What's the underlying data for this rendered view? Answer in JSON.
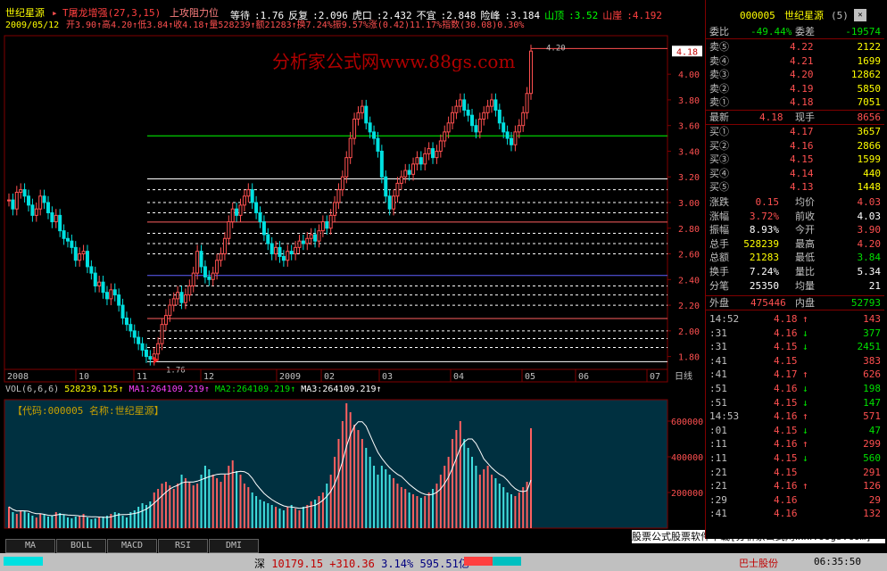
{
  "header": {
    "stock_name": "世纪星源",
    "indicator": "T屠龙增强(27,3,15)",
    "support": "上攻阻力位",
    "fields": [
      {
        "label": "等待",
        "value": "1.76"
      },
      {
        "label": "反复",
        "value": "2.096"
      },
      {
        "label": "虎口",
        "value": "2.432"
      },
      {
        "label": "不宜",
        "value": "2.848"
      },
      {
        "label": "险峰",
        "value": "3.184"
      },
      {
        "label": "山顶",
        "value": "3.52"
      },
      {
        "label": "山崖",
        "value": "4.192"
      }
    ],
    "date": "2009/05/12",
    "day_stats": "开3.90↑高4.20↑低3.84↑收4.18↑量528239↑额21283↑换7.24%振9.57%涨(0.42)11.17%指数(30.08)0.30%"
  },
  "watermark": "分析家公式网www.88gs.com",
  "chart_data": {
    "type": "candlestick",
    "price_axis": {
      "min": 1.7,
      "max": 4.3,
      "ticks": [
        "4.00",
        "3.80",
        "3.60",
        "3.40",
        "3.20",
        "3.00",
        "2.80",
        "2.60",
        "2.40",
        "2.20",
        "2.00",
        "1.80"
      ],
      "current_label": "4.18"
    },
    "time_axis": [
      "2008",
      "10",
      "11",
      "12",
      "2009",
      "02",
      "03",
      "04",
      "05",
      "06",
      "07"
    ],
    "annotations": {
      "high_label": "4.20",
      "low_label": "1.76",
      "period": "日线"
    },
    "levels": [
      3.52,
      3.184,
      3.1,
      3.0,
      2.92,
      2.848,
      2.76,
      2.68,
      2.6,
      2.432,
      2.35,
      2.28,
      2.2,
      2.096,
      2.0,
      1.94,
      1.87,
      1.76
    ],
    "closes": [
      3.02,
      2.95,
      3.08,
      3.1,
      3.05,
      2.98,
      2.9,
      2.95,
      3.05,
      3.0,
      2.92,
      2.85,
      2.9,
      2.78,
      2.72,
      2.7,
      2.65,
      2.55,
      2.6,
      2.62,
      2.5,
      2.45,
      2.35,
      2.38,
      2.3,
      2.25,
      2.32,
      2.28,
      2.2,
      2.1,
      2.05,
      2.0,
      1.95,
      1.9,
      1.85,
      1.8,
      1.78,
      1.82,
      1.9,
      2.05,
      2.12,
      2.2,
      2.25,
      2.3,
      2.22,
      2.28,
      2.35,
      2.45,
      2.62,
      2.5,
      2.42,
      2.4,
      2.45,
      2.55,
      2.6,
      2.72,
      2.85,
      2.95,
      2.9,
      2.98,
      3.05,
      3.1,
      3.0,
      2.92,
      2.85,
      2.75,
      2.68,
      2.6,
      2.65,
      2.58,
      2.55,
      2.62,
      2.6,
      2.65,
      2.7,
      2.68,
      2.72,
      2.75,
      2.7,
      2.78,
      2.85,
      2.8,
      2.9,
      3.0,
      3.1,
      3.2,
      3.35,
      3.5,
      3.65,
      3.7,
      3.75,
      3.62,
      3.55,
      3.5,
      3.4,
      3.2,
      3.05,
      2.95,
      3.05,
      3.15,
      3.2,
      3.25,
      3.22,
      3.3,
      3.35,
      3.3,
      3.38,
      3.42,
      3.35,
      3.4,
      3.48,
      3.55,
      3.62,
      3.7,
      3.75,
      3.8,
      3.72,
      3.68,
      3.6,
      3.55,
      3.65,
      3.7,
      3.75,
      3.8,
      3.72,
      3.62,
      3.55,
      3.5,
      3.45,
      3.55,
      3.6,
      3.7,
      3.85,
      4.18
    ],
    "volume": {
      "label": "VOL(6,6,6)",
      "value": "528239.125",
      "ma1": "MA1:264109.219",
      "ma2": "MA2:264109.219",
      "ma3": "MA3:264109.219",
      "ticks": [
        "600000",
        "400000",
        "200000"
      ],
      "max": 720000
    },
    "volumes": [
      120000,
      90000,
      80000,
      100000,
      95000,
      85000,
      70000,
      60000,
      80000,
      75000,
      65000,
      70000,
      90000,
      85000,
      75000,
      60000,
      55000,
      65000,
      70000,
      80000,
      60000,
      50000,
      55000,
      60000,
      65000,
      70000,
      80000,
      90000,
      85000,
      70000,
      60000,
      90000,
      100000,
      120000,
      140000,
      130000,
      150000,
      200000,
      220000,
      250000,
      260000,
      240000,
      220000,
      250000,
      300000,
      280000,
      260000,
      240000,
      250000,
      300000,
      350000,
      330000,
      300000,
      280000,
      260000,
      300000,
      350000,
      380000,
      320000,
      300000,
      250000,
      230000,
      200000,
      180000,
      160000,
      150000,
      140000,
      130000,
      120000,
      110000,
      100000,
      120000,
      130000,
      110000,
      100000,
      120000,
      130000,
      150000,
      160000,
      180000,
      200000,
      250000,
      300000,
      400000,
      500000,
      600000,
      700000,
      650000,
      580000,
      550000,
      500000,
      450000,
      400000,
      350000,
      300000,
      350000,
      330000,
      300000,
      280000,
      250000,
      230000,
      220000,
      200000,
      190000,
      180000,
      170000,
      180000,
      200000,
      220000,
      250000,
      300000,
      350000,
      400000,
      500000,
      550000,
      600000,
      500000,
      450000,
      400000,
      350000,
      300000,
      330000,
      350000,
      300000,
      280000,
      250000,
      230000,
      200000,
      190000,
      180000,
      200000,
      230000,
      260000,
      560000
    ]
  },
  "sub_window": {
    "title": "【代码:000005 名称:世纪星源】"
  },
  "right": {
    "code": "000005",
    "name": "世纪星源",
    "tag": "(5)",
    "weibi_label": "委比",
    "weibi_value": "-49.44%",
    "weicha_label": "委差",
    "weicha_value": "-19574",
    "sell": [
      {
        "label": "卖⑤",
        "price": "4.22",
        "vol": "2122"
      },
      {
        "label": "卖④",
        "price": "4.21",
        "vol": "1699"
      },
      {
        "label": "卖③",
        "price": "4.20",
        "vol": "12862"
      },
      {
        "label": "卖②",
        "price": "4.19",
        "vol": "5850"
      },
      {
        "label": "卖①",
        "price": "4.18",
        "vol": "7051"
      }
    ],
    "latest": {
      "label": "最新",
      "price": "4.18",
      "label2": "现手",
      "vol": "8656"
    },
    "buy": [
      {
        "label": "买①",
        "price": "4.17",
        "vol": "3657"
      },
      {
        "label": "买②",
        "price": "4.16",
        "vol": "2866"
      },
      {
        "label": "买③",
        "price": "4.15",
        "vol": "1599"
      },
      {
        "label": "买④",
        "price": "4.14",
        "vol": "440"
      },
      {
        "label": "买⑤",
        "price": "4.13",
        "vol": "1448"
      }
    ],
    "stats": [
      {
        "l1": "涨跌",
        "v1": "0.15",
        "l2": "均价",
        "v2": "4.03"
      },
      {
        "l1": "涨幅",
        "v1": "3.72%",
        "l2": "前收",
        "v2": "4.03"
      },
      {
        "l1": "振幅",
        "v1": "8.93%",
        "l2": "今开",
        "v2": "3.90"
      },
      {
        "l1": "总手",
        "v1": "528239",
        "l2": "最高",
        "v2": "4.20"
      },
      {
        "l1": "总额",
        "v1": "21283",
        "l2": "最低",
        "v2": "3.84"
      },
      {
        "l1": "换手",
        "v1": "7.24%",
        "l2": "量比",
        "v2": "5.34"
      },
      {
        "l1": "分笔",
        "v1": "25350",
        "l2": "均量",
        "v2": "21"
      }
    ],
    "outer": {
      "l1": "外盘",
      "v1": "475446",
      "l2": "内盘",
      "v2": "52793"
    },
    "ticks": [
      {
        "t": "14:52",
        "p": "4.18",
        "d": "up",
        "v": "143"
      },
      {
        "t": ":31",
        "p": "4.16",
        "d": "down",
        "v": "377"
      },
      {
        "t": ":31",
        "p": "4.15",
        "d": "down",
        "v": "2451"
      },
      {
        "t": ":41",
        "p": "4.15",
        "d": "",
        "v": "383"
      },
      {
        "t": ":41",
        "p": "4.17",
        "d": "up",
        "v": "626"
      },
      {
        "t": ":51",
        "p": "4.16",
        "d": "down",
        "v": "198"
      },
      {
        "t": ":51",
        "p": "4.15",
        "d": "down",
        "v": "147"
      },
      {
        "t": "14:53",
        "p": "4.16",
        "d": "up",
        "v": "571"
      },
      {
        "t": ":01",
        "p": "4.15",
        "d": "down",
        "v": "47"
      },
      {
        "t": ":11",
        "p": "4.16",
        "d": "up",
        "v": "299"
      },
      {
        "t": ":11",
        "p": "4.15",
        "d": "down",
        "v": "560"
      },
      {
        "t": ":21",
        "p": "4.15",
        "d": "",
        "v": "291"
      },
      {
        "t": ":21",
        "p": "4.16",
        "d": "up",
        "v": "126"
      },
      {
        "t": ":29",
        "p": "4.16",
        "d": "",
        "v": "29"
      },
      {
        "t": ":41",
        "p": "4.16",
        "d": "",
        "v": "132"
      }
    ]
  },
  "tabs": [
    "MA",
    "BOLL",
    "MACD",
    "RSI",
    "DMI"
  ],
  "promo": "股票公式股票软件下载[分析家公式网www.88gs.com]",
  "status_bar": {
    "market": "深",
    "index": "10179.15",
    "change": "+310.36",
    "pct": "3.14%",
    "amount": "595.51亿",
    "right_text": "巴士股份",
    "time": "06:35:50"
  }
}
